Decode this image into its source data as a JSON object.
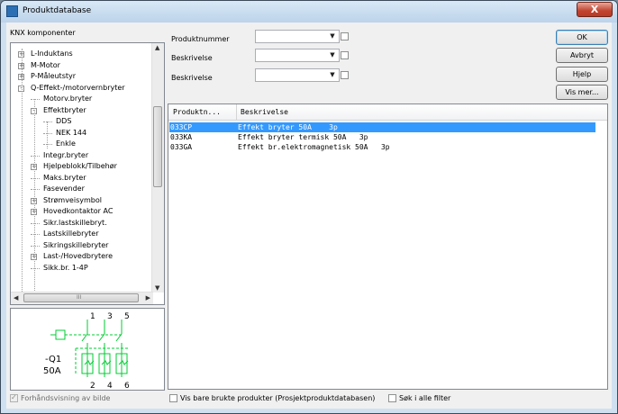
{
  "window": {
    "title": "Produktdatabase",
    "close_glyph": "X"
  },
  "left_panel": {
    "tree_label": "KNX komponenter",
    "tree_items": [
      {
        "label": "L-Induktans",
        "level": 0,
        "expander": "+"
      },
      {
        "label": "M-Motor",
        "level": 0,
        "expander": "+"
      },
      {
        "label": "P-Måleutstyr",
        "level": 0,
        "expander": "+"
      },
      {
        "label": "Q-Effekt-/motorvernbryter",
        "level": 0,
        "expander": "-"
      },
      {
        "label": "Motorv.bryter",
        "level": 1,
        "expander": ""
      },
      {
        "label": "Effektbryter",
        "level": 1,
        "expander": "-"
      },
      {
        "label": "DDS",
        "level": 2,
        "expander": ""
      },
      {
        "label": "NEK 144",
        "level": 2,
        "expander": ""
      },
      {
        "label": "Enkle",
        "level": 2,
        "expander": ""
      },
      {
        "label": "Integr.bryter",
        "level": 1,
        "expander": ""
      },
      {
        "label": "Hjelpeblokk/Tilbehør",
        "level": 1,
        "expander": "+"
      },
      {
        "label": "Maks.bryter",
        "level": 1,
        "expander": ""
      },
      {
        "label": "Fasevender",
        "level": 1,
        "expander": ""
      },
      {
        "label": "Strømveisymbol",
        "level": 1,
        "expander": "+"
      },
      {
        "label": "Hovedkontaktor AC",
        "level": 1,
        "expander": "+"
      },
      {
        "label": "Sikr.lastskillebryt.",
        "level": 1,
        "expander": ""
      },
      {
        "label": "Lastskillebryter",
        "level": 1,
        "expander": ""
      },
      {
        "label": "Sikringskillebryter",
        "level": 1,
        "expander": ""
      },
      {
        "label": "Last-/Hovedbrytere",
        "level": 1,
        "expander": "+"
      },
      {
        "label": "Sikk.br. 1-4P",
        "level": 1,
        "expander": ""
      }
    ],
    "hscroll_grip": "III",
    "preview_symbol": {
      "reference": "-Q1",
      "rating": "50A",
      "terminals_top": [
        "1",
        "3",
        "5"
      ],
      "terminals_bottom": [
        "2",
        "4",
        "6"
      ],
      "color": "#00cc33"
    },
    "preview_checkbox_label": "Forhåndsvisning av bilde",
    "preview_checked": true
  },
  "filters": [
    {
      "label": "Produktnummer",
      "value": ""
    },
    {
      "label": "Beskrivelse",
      "value": ""
    },
    {
      "label": "Beskrivelse",
      "value": ""
    }
  ],
  "buttons": {
    "ok": "OK",
    "cancel": "Avbryt",
    "help": "Hjelp",
    "more": "Vis mer..."
  },
  "results": {
    "columns": [
      "Produktn...",
      "Beskrivelse"
    ],
    "rows": [
      {
        "number": "033CP",
        "description": "Effekt bryter 50A    3p",
        "selected": true
      },
      {
        "number": "033KA",
        "description": "Effekt bryter termisk 50A   3p",
        "selected": false
      },
      {
        "number": "033GA",
        "description": "Effekt br.elektromagnetisk 50A   3p",
        "selected": false
      }
    ]
  },
  "bottom": {
    "project_only_label": "Vis bare brukte produkter (Prosjektproduktdatabasen)",
    "search_all_label": "Søk i alle filter"
  },
  "colors": {
    "selection": "#3399ff",
    "window_frame": "#cfe0f1",
    "symbol_green": "#00cc33"
  }
}
